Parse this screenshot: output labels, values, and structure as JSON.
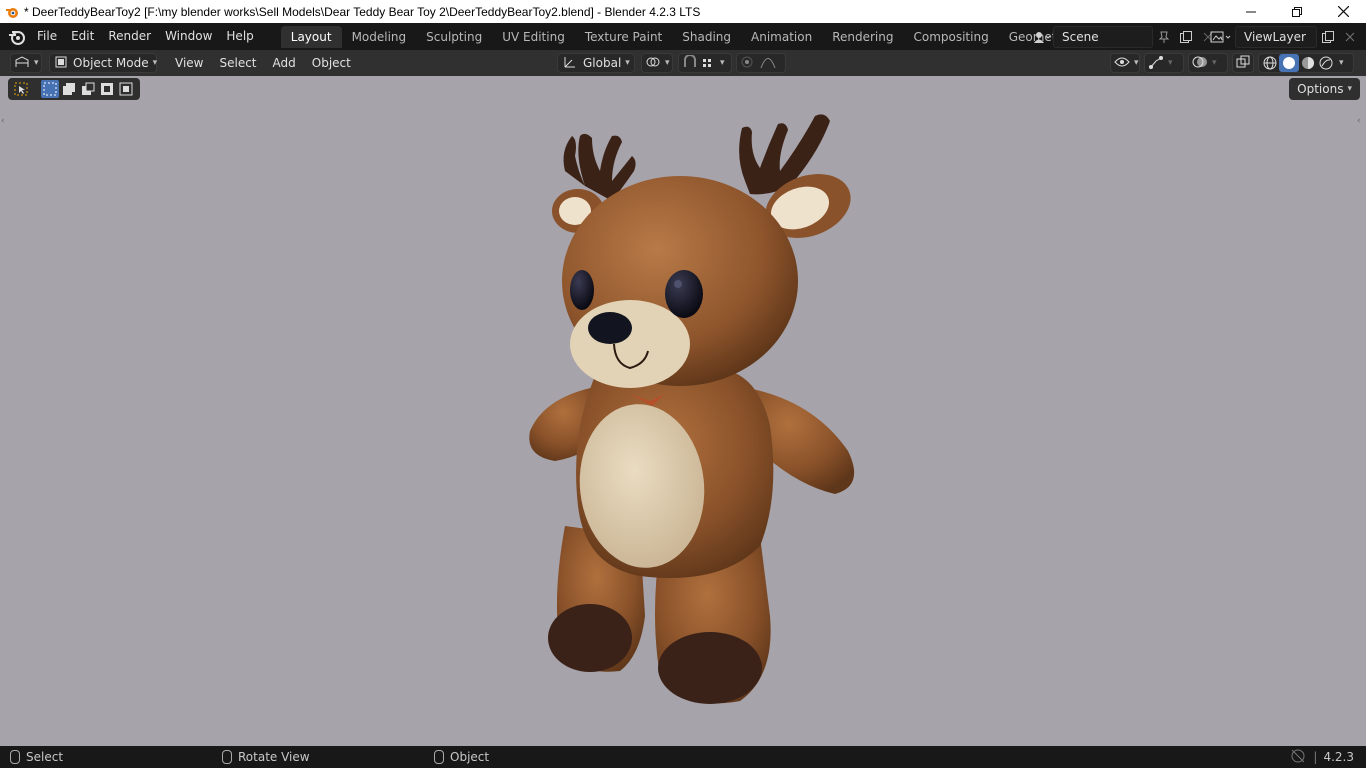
{
  "window": {
    "title": "* DeerTeddyBearToy2 [F:\\my blender works\\Sell Models\\Dear Teddy Bear Toy 2\\DeerTeddyBearToy2.blend] - Blender 4.2.3 LTS",
    "minimize_icon": "minimize-icon",
    "maximize_icon": "restore-icon",
    "close_icon": "close-icon"
  },
  "menu": {
    "items": [
      "File",
      "Edit",
      "Render",
      "Window",
      "Help"
    ]
  },
  "workspaces": {
    "tabs": [
      "Layout",
      "Modeling",
      "Sculpting",
      "UV Editing",
      "Texture Paint",
      "Shading",
      "Animation",
      "Rendering",
      "Compositing",
      "Geometry Nodes"
    ],
    "active": "Layout"
  },
  "scene": {
    "name": "Scene"
  },
  "view_layer": {
    "name": "ViewLayer"
  },
  "viewport_header": {
    "mode": "Object Mode",
    "menus": [
      "View",
      "Select",
      "Add",
      "Object"
    ],
    "transform_orientation": "Global"
  },
  "viewport": {
    "options_label": "Options",
    "background_color": "#a6a3aa"
  },
  "statusbar": {
    "select": "Select",
    "rotate": "Rotate View",
    "object": "Object",
    "version": "4.2.3"
  }
}
